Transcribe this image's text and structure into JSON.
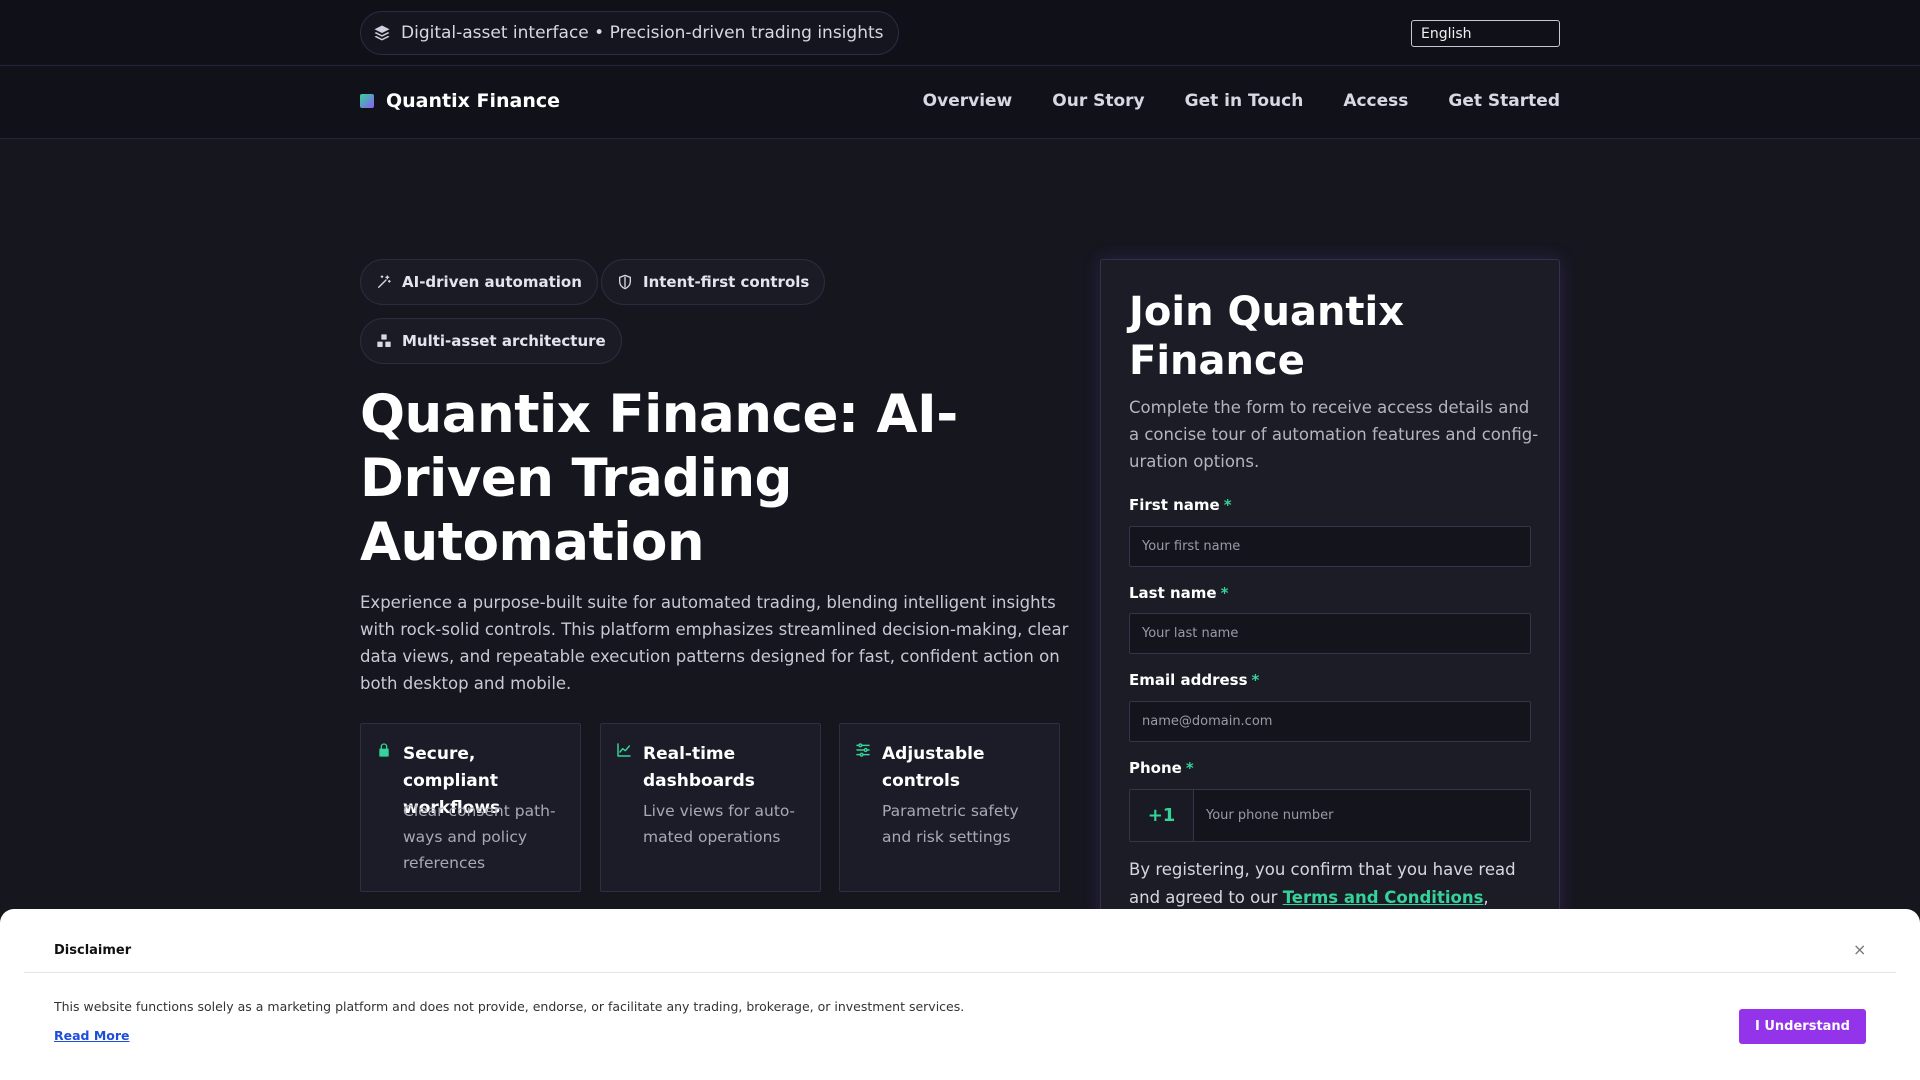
{
  "topbar": {
    "tagline": "Digital-asset interface • Precision-driven trading insights",
    "tagline_icon": "layers-icon",
    "language": "English"
  },
  "nav": {
    "brand": "Quantix Finance",
    "links": [
      "Overview",
      "Our Story",
      "Get in Touch",
      "Access",
      "Get Started"
    ]
  },
  "hero": {
    "chips": [
      {
        "label": "AI-driven automation",
        "icon": "magic-wand-icon"
      },
      {
        "label": "Intent-first controls",
        "icon": "shield-icon"
      },
      {
        "label": "Multi-asset architecture",
        "icon": "cubes-icon"
      }
    ],
    "title": "Quantix Finance: AI-Driven Trading Automation",
    "description": "Experience a purpose-built suite for automated trading, blending intelligent insights with rock-solid controls. This platform emphasizes streamlined decision-making, clear data views, and repeatable execution patterns designed for fast, confident action on both desktop and mobile.",
    "features": [
      {
        "title": "Secure, compliant workflows",
        "desc": "Clear consent path­ways and policy references",
        "icon": "lock-icon"
      },
      {
        "title": "Real-time dashboards",
        "desc": "Live views for auto­mated operations",
        "icon": "chart-line-icon"
      },
      {
        "title": "Adjustable controls",
        "desc": "Parametric safety and risk settings",
        "icon": "sliders-icon"
      }
    ]
  },
  "form": {
    "title": "Join Quantix Finance",
    "subtitle": "Complete the form to receive access details and a concise tour of automation features and config­uration options.",
    "first_name_label": "First name",
    "first_name_placeholder": "Your first name",
    "last_name_label": "Last name",
    "last_name_placeholder": "Your last name",
    "email_label": "Email address",
    "email_placeholder": "name@domain.com",
    "phone_label": "Phone",
    "phone_code": "+1",
    "phone_placeholder": "Your phone number",
    "required_mark": "*",
    "consent_prefix": "By registering, you confirm that you have read and agreed to our ",
    "terms_link": "Terms and Conditions",
    "consent_suffix": ","
  },
  "disclaimer": {
    "title": "Disclaimer",
    "close": "×",
    "text": "This website functions solely as a marketing platform and does not provide, endorse, or facilitate any trading, brokerage, or investment services.",
    "read_more": "Read More",
    "button": "I Understand"
  },
  "colors": {
    "accent_green": "#34d399",
    "accent_purple": "#9333ea",
    "background": "#16161f"
  }
}
